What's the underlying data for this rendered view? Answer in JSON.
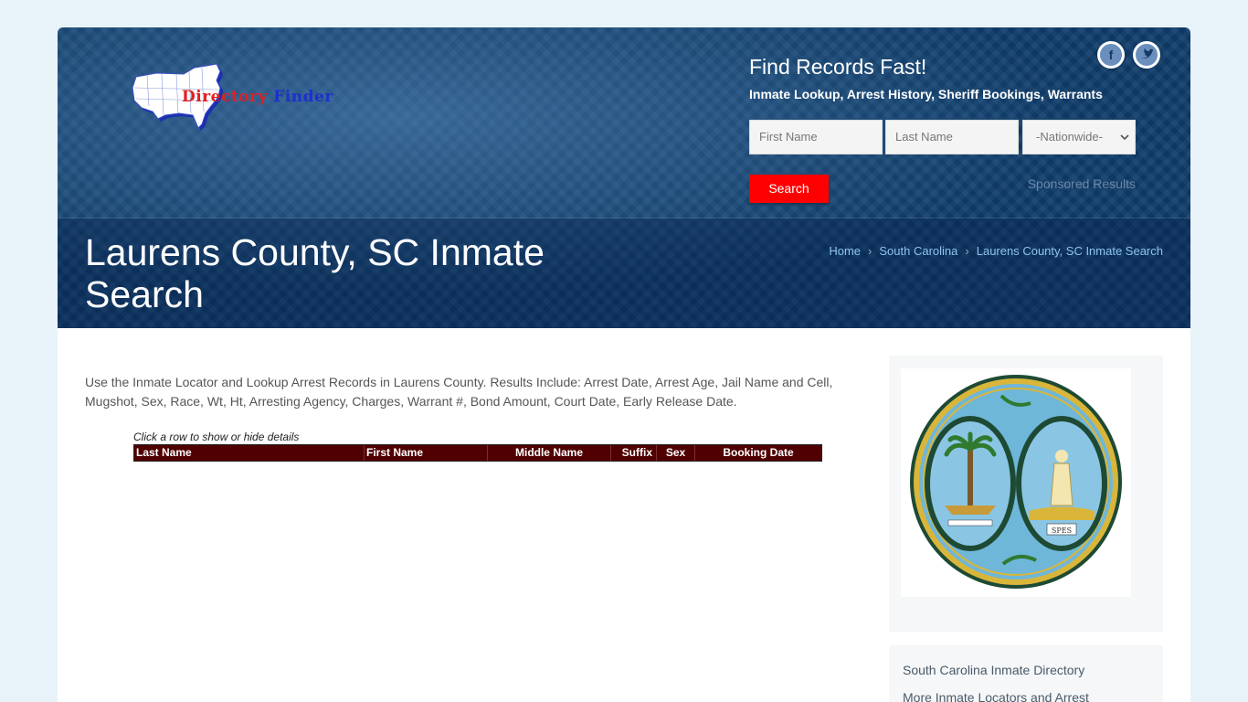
{
  "logo": {
    "word1": "Directory",
    "word2": "Finder"
  },
  "social": {
    "facebook_glyph": "f",
    "twitter_glyph": "t"
  },
  "search": {
    "title": "Find Records Fast!",
    "subtitle": "Inmate Lookup, Arrest History, Sheriff Bookings, Warrants",
    "first_name_placeholder": "First Name",
    "last_name_placeholder": "Last Name",
    "region_selected": "-Nationwide-",
    "button_label": "Search",
    "sponsored": "Sponsored Results"
  },
  "page": {
    "title": "Laurens County, SC Inmate Search",
    "breadcrumb": [
      "Home",
      "South Carolina",
      "Laurens County, SC Inmate Search"
    ]
  },
  "intro": "Use the Inmate Locator and Lookup Arrest Records in Laurens County. Results Include: Arrest Date, Arrest Age, Jail Name and Cell, Mugshot, Sex, Race, Wt, Ht, Arresting Agency, Charges, Warrant #, Bond Amount, Court Date, Early Release Date.",
  "results": {
    "hint": "Click a row to show or hide details",
    "columns": [
      "Last Name",
      "First Name",
      "Middle Name",
      "Suffix",
      "Sex",
      "Booking Date"
    ]
  },
  "sidebar": {
    "links": [
      "South Carolina Inmate Directory",
      "More Inmate Locators and Arrest"
    ]
  },
  "colors": {
    "header_blue": "#0f3c6a",
    "search_red": "#ff0000",
    "table_header": "#500000",
    "breadcrumb_link": "#8fc3ef"
  }
}
